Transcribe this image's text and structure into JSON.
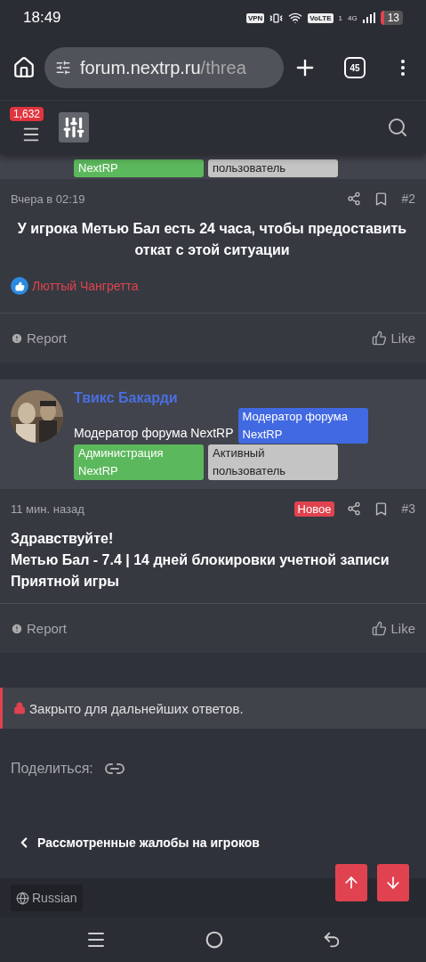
{
  "status_bar": {
    "time": "18:49",
    "vpn": "VPN",
    "volte": "VoLTE",
    "sim": "1",
    "network": "4G",
    "battery": "13"
  },
  "browser": {
    "url_host": "forum.nextrp.ru",
    "url_path": "/threa",
    "tab_count": "45"
  },
  "forum_header": {
    "notification_count": "1,632"
  },
  "previous_banners": [
    {
      "text": "NextRP",
      "color": "#5cb85c"
    },
    {
      "text": "пользователь",
      "color": "#c4c4c4"
    }
  ],
  "posts": [
    {
      "date": "Вчера в 02:19",
      "number": "#2",
      "kind": "centered",
      "body": [
        "У игрока Метью Бал есть 24 часа, чтобы предоставить откат с этой ситуации"
      ],
      "reaction_user": "Люттый Чангретта",
      "report": "Report",
      "like": "Like"
    },
    {
      "author": {
        "name": "Твикс Бакарди",
        "title": "Модератор форума NextRP",
        "banners": [
          {
            "text": "Модератор форума NextRP",
            "color": "#4169e1"
          },
          {
            "text": "Администрация NextRP",
            "color": "#5cb85c"
          },
          {
            "text": "Активный пользователь",
            "color": "#c4c4c4"
          }
        ]
      },
      "date": "11 мин. назад",
      "new_label": "Новое",
      "number": "#3",
      "kind": "plain",
      "body": [
        "Здравствуйте!",
        "Метью Бал - 7.4 | 14 дней блокировки учетной записи",
        "Приятной игры"
      ],
      "report": "Report",
      "like": "Like"
    }
  ],
  "locked_notice": "Закрыто для дальнейших ответов.",
  "share_label": "Поделиться:",
  "breadcrumb": "Рассмотренные жалобы на игроков",
  "language": "Russian"
}
